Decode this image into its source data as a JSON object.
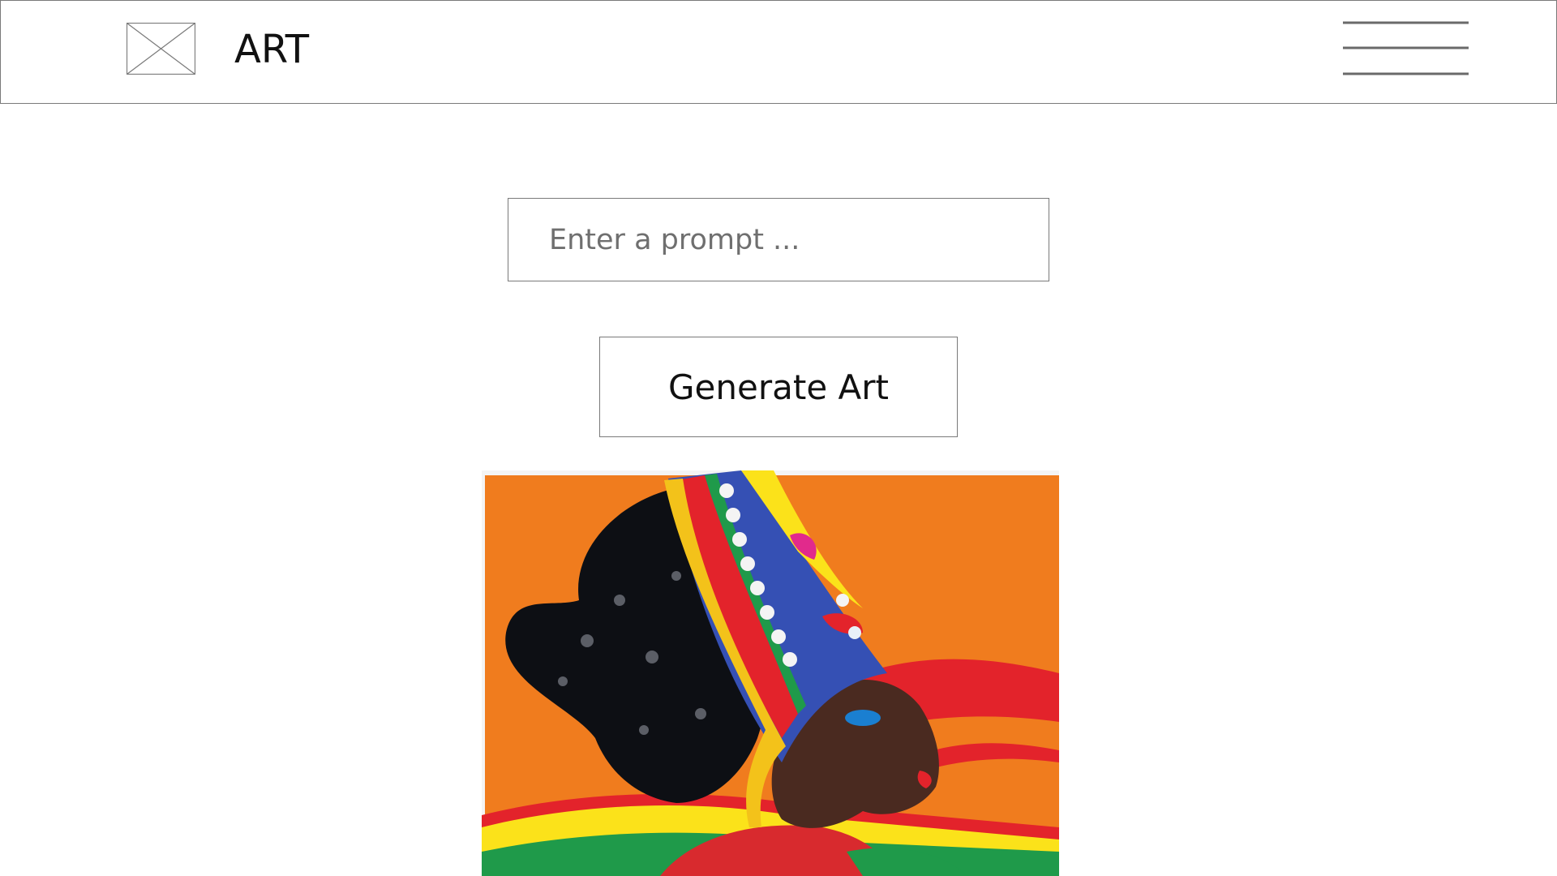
{
  "header": {
    "title": "ART",
    "logo_icon": "image-placeholder-icon",
    "menu_icon": "hamburger-menu-icon"
  },
  "prompt": {
    "value": "",
    "placeholder": "Enter a prompt ..."
  },
  "generate_button": {
    "label": "Generate Art"
  },
  "result": {
    "image_icon": "generated-art-image",
    "colors": {
      "background": "#f07c1e",
      "red": "#e3232b",
      "yellow": "#fbe21a",
      "green": "#1f9a4a",
      "hair": "#0d0f14",
      "skin": "#4a2a20"
    }
  }
}
